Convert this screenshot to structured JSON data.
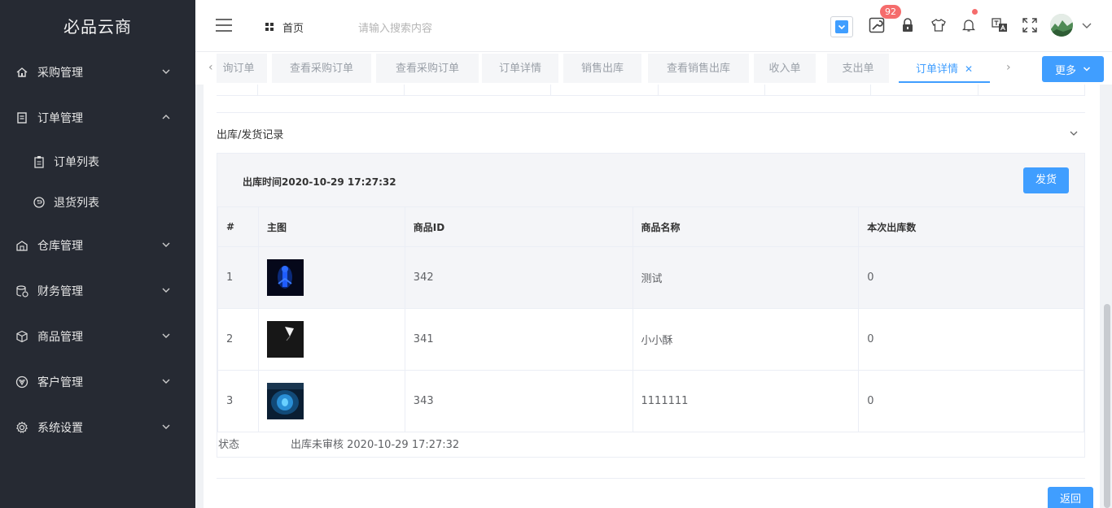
{
  "app": {
    "brand": "必品云商"
  },
  "sidebar": {
    "items": [
      {
        "label": "采购管理",
        "icon": "home-icon"
      },
      {
        "label": "订单管理",
        "icon": "document-icon",
        "expanded": true,
        "children": [
          {
            "label": "订单列表",
            "icon": "clipboard-icon"
          },
          {
            "label": "退货列表",
            "icon": "return-icon"
          }
        ]
      },
      {
        "label": "仓库管理",
        "icon": "warehouse-icon"
      },
      {
        "label": "财务管理",
        "icon": "finance-icon"
      },
      {
        "label": "商品管理",
        "icon": "box-icon"
      },
      {
        "label": "客户管理",
        "icon": "vue-icon"
      },
      {
        "label": "系统设置",
        "icon": "gear-icon"
      }
    ]
  },
  "header": {
    "home_label": "首页",
    "search_placeholder": "请输入搜索内容",
    "badge_count": "92",
    "accent": "#409eff",
    "badge_color": "#f56c6c"
  },
  "tabs": {
    "items": [
      {
        "label": "询订单"
      },
      {
        "label": "查看采购订单"
      },
      {
        "label": "查看采购订单"
      },
      {
        "label": "订单详情"
      },
      {
        "label": "销售出库"
      },
      {
        "label": "查看销售出库"
      },
      {
        "label": "收入单"
      },
      {
        "label": "支出单"
      },
      {
        "label": "订单详情",
        "active": true
      }
    ],
    "more_label": "更多"
  },
  "main": {
    "section_title": "出库/发货记录",
    "out_time": "出库时间2020-10-29 17:27:32",
    "ship_button": "发货",
    "table": {
      "headers": [
        "#",
        "主图",
        "商品ID",
        "商品名称",
        "本次出库数"
      ],
      "rows": [
        {
          "index": "1",
          "image": "blue-figure-thumb",
          "id": "342",
          "name": "测试",
          "qty": "0"
        },
        {
          "index": "2",
          "image": "dark-light-thumb",
          "id": "341",
          "name": "小小酥",
          "qty": "0"
        },
        {
          "index": "3",
          "image": "blue-glow-thumb",
          "id": "343",
          "name": "1111111",
          "qty": "0"
        }
      ]
    },
    "status_label": "状态",
    "status_value": "出库未审核 2020-10-29 17:27:32",
    "back_button": "返回"
  }
}
